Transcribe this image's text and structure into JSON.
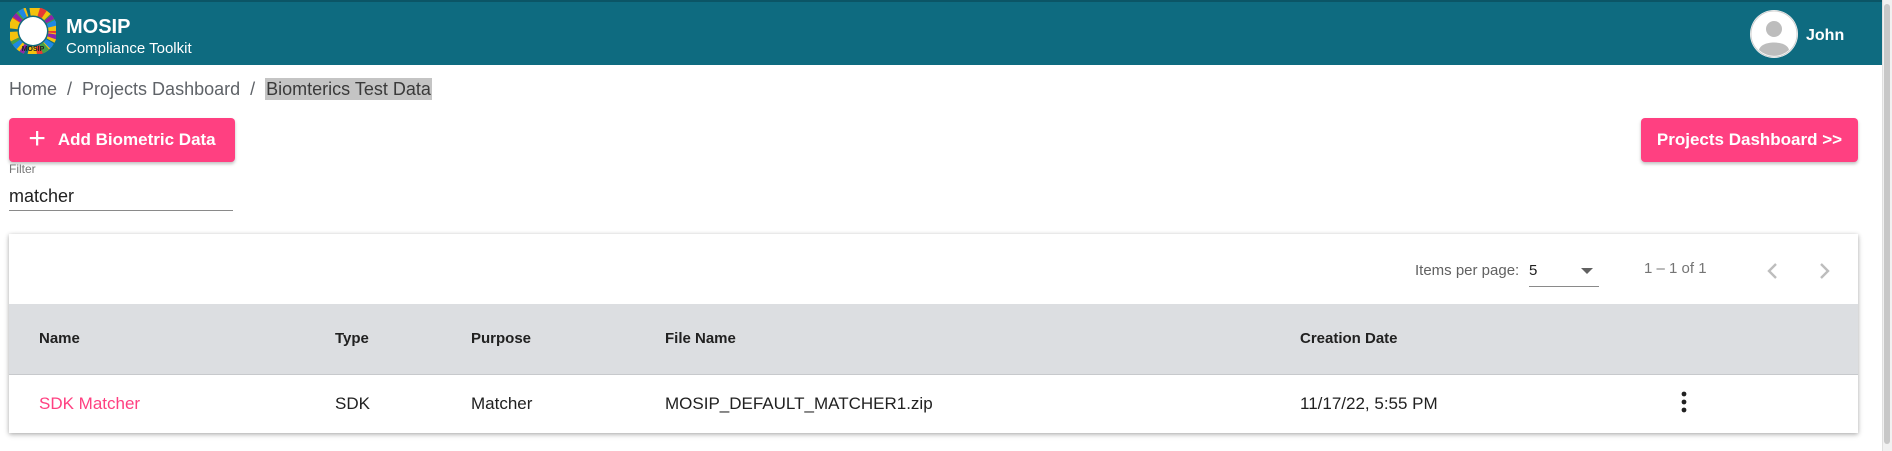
{
  "header": {
    "app_name": "MOSIP",
    "app_subtitle": "Compliance Toolkit",
    "logo_text": "MOSIP",
    "username": "John",
    "colors": {
      "bar": "#0e6b80",
      "accent": "#ff4081"
    }
  },
  "breadcrumb": {
    "items": [
      "Home",
      "Projects Dashboard"
    ],
    "current": "Biomterics Test Data",
    "separator": "/"
  },
  "toolbar": {
    "add_label": "Add Biometric Data",
    "add_icon": "plus-icon",
    "dashboard_label": "Projects Dashboard >>"
  },
  "filter": {
    "label": "Filter",
    "value": "matcher"
  },
  "paginator": {
    "items_per_page_label": "Items per page:",
    "items_per_page_value": "5",
    "range": "1 – 1 of 1"
  },
  "table": {
    "columns": [
      "Name",
      "Type",
      "Purpose",
      "File Name",
      "Creation Date"
    ],
    "rows": [
      {
        "name": "SDK Matcher",
        "type": "SDK",
        "purpose": "Matcher",
        "file_name": "MOSIP_DEFAULT_MATCHER1.zip",
        "creation_date": "11/17/22, 5:55 PM"
      }
    ]
  }
}
